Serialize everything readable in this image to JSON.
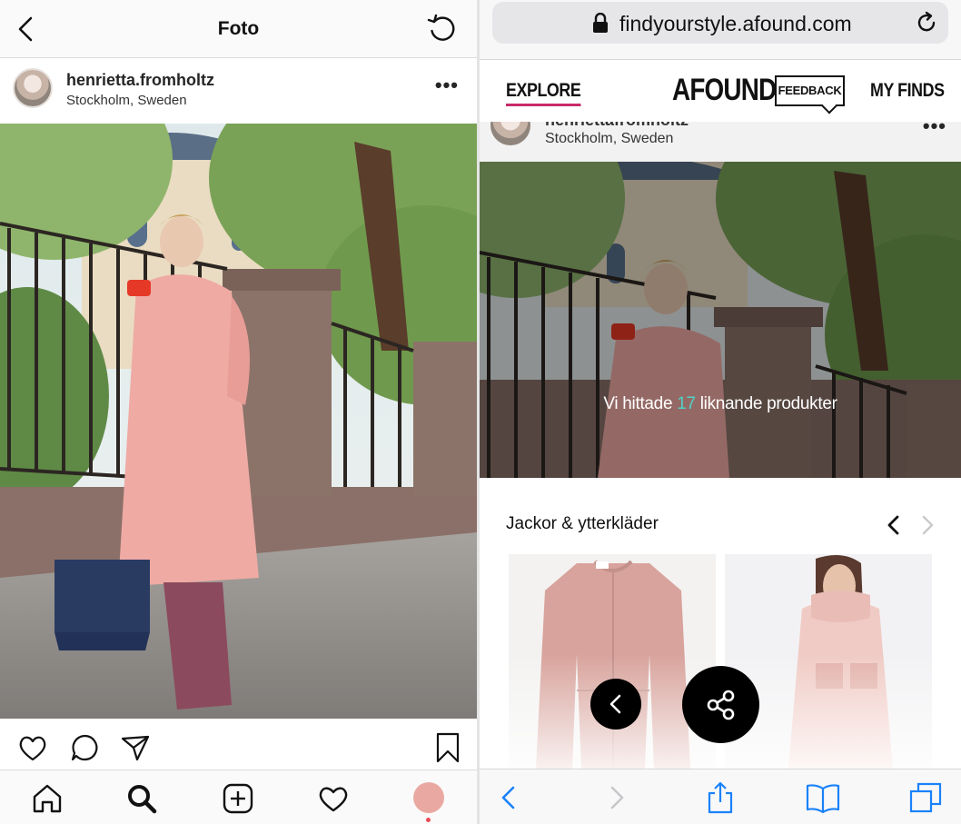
{
  "instagram": {
    "header_title": "Foto",
    "username": "henrietta.fromholtz",
    "location": "Stockholm, Sweden",
    "more_label": "•••"
  },
  "browser": {
    "url": "findyourstyle.afound.com"
  },
  "site": {
    "nav_explore": "EXPLORE",
    "brand": "AFOUND",
    "feedback_label": "FEEDBACK",
    "nav_my_finds": "MY FINDS",
    "peek_username": "henriettafromholtz",
    "peek_location": "Stockholm, Sweden",
    "result_prefix": "Vi hittade ",
    "result_count": "17",
    "result_suffix": " liknande produkter",
    "section_title": "Jackor & ytterkläder"
  },
  "colors": {
    "accent_underline": "#c72a6b",
    "result_count": "#4fd1c5",
    "ios_blue": "#1a82fb",
    "ig_notification": "#ed4956"
  }
}
